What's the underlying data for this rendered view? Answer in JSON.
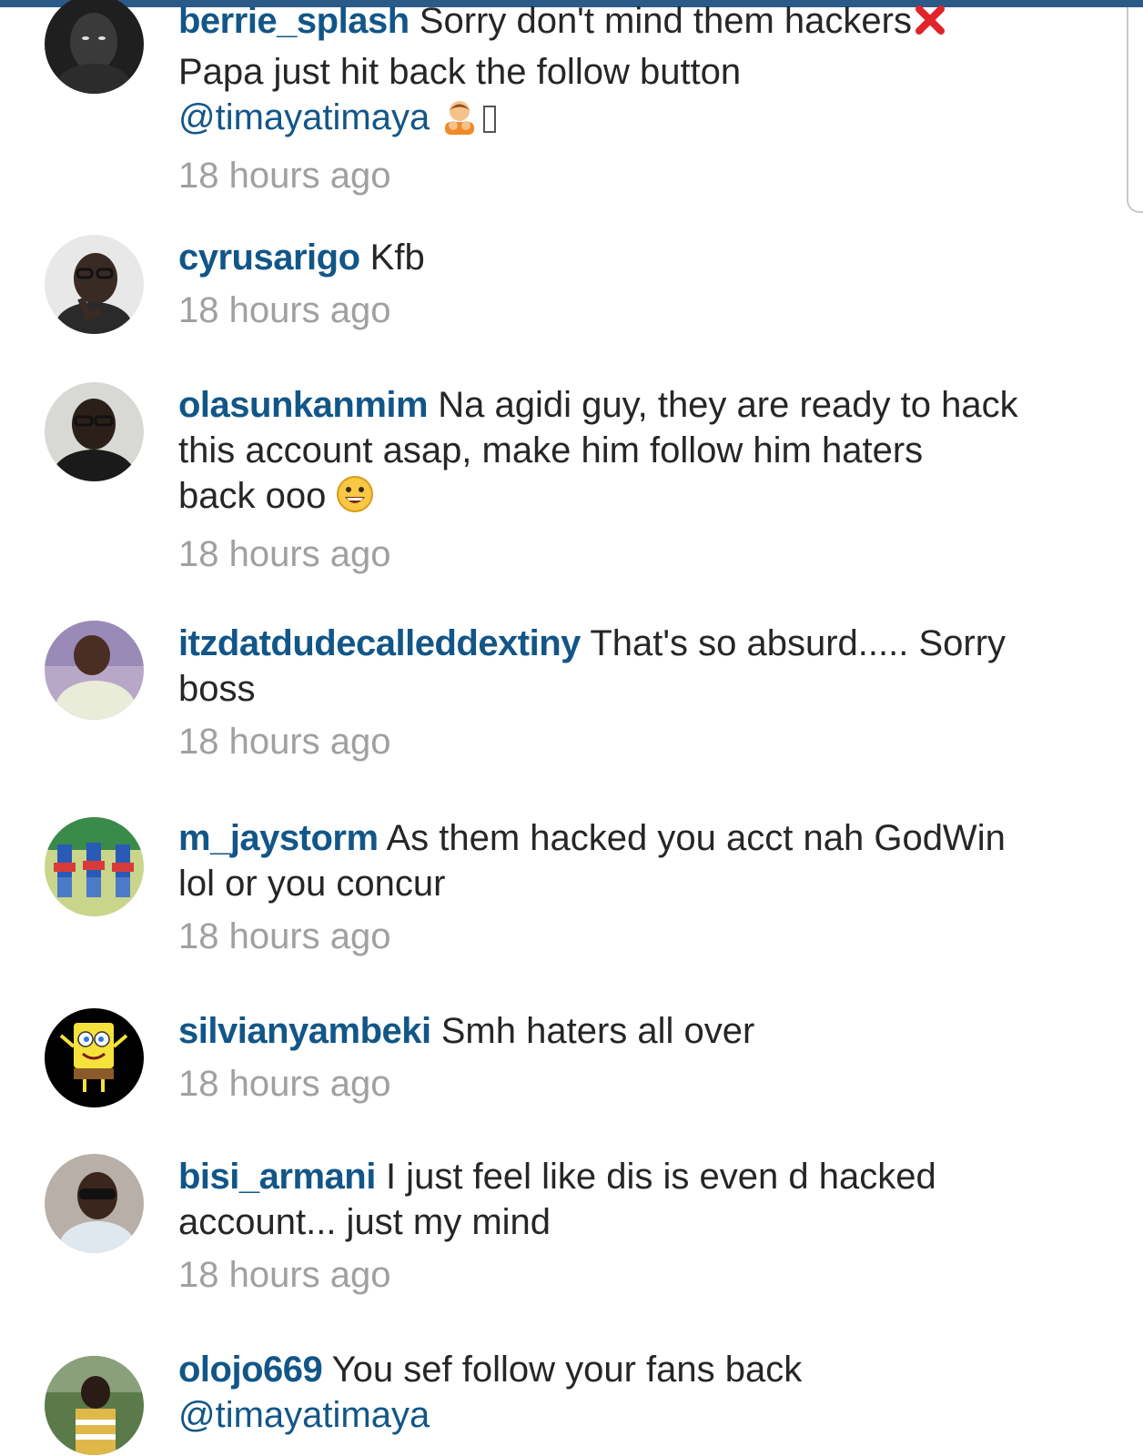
{
  "colors": {
    "username": "#125688",
    "body_text": "#262626",
    "timestamp": "#a0a0a0",
    "top_bar": "#2b5a88"
  },
  "comments": [
    {
      "username": "berrie_splash",
      "text": "Sorry don't mind them hackers",
      "text_line2": "Papa just hit back the follow button",
      "mention": "@timayatimaya",
      "emoji_icons": [
        "cross-mark-icon",
        "person-bowing-icon",
        "missing-glyph-icon"
      ],
      "time": "18 hours ago"
    },
    {
      "username": "cyrusarigo",
      "text": "Kfb",
      "time": "18 hours ago"
    },
    {
      "username": "olasunkanmim",
      "text": "Na agidi guy, they are ready to hack",
      "text_line2": "this account asap, make him follow him haters",
      "text_line3": "back ooo",
      "emoji_icons": [
        "grinning-face-icon"
      ],
      "time": "18 hours ago"
    },
    {
      "username": "itzdatdudecalleddextiny",
      "text": "That's so absurd..... Sorry",
      "text_line2": "boss",
      "time": "18 hours ago"
    },
    {
      "username": "m_jaystorm",
      "text": "As them hacked you acct nah GodWin",
      "text_line2": "lol or you concur",
      "time": "18 hours ago"
    },
    {
      "username": "silvianyambeki",
      "text": "Smh haters all over",
      "time": "18 hours ago"
    },
    {
      "username": "bisi_armani",
      "text": "I just feel like dis is even d hacked",
      "text_line2": "account... just my mind",
      "time": "18 hours ago"
    },
    {
      "username": "olojo669",
      "text": "You sef follow your fans back",
      "mention": "@timayatimaya"
    }
  ]
}
